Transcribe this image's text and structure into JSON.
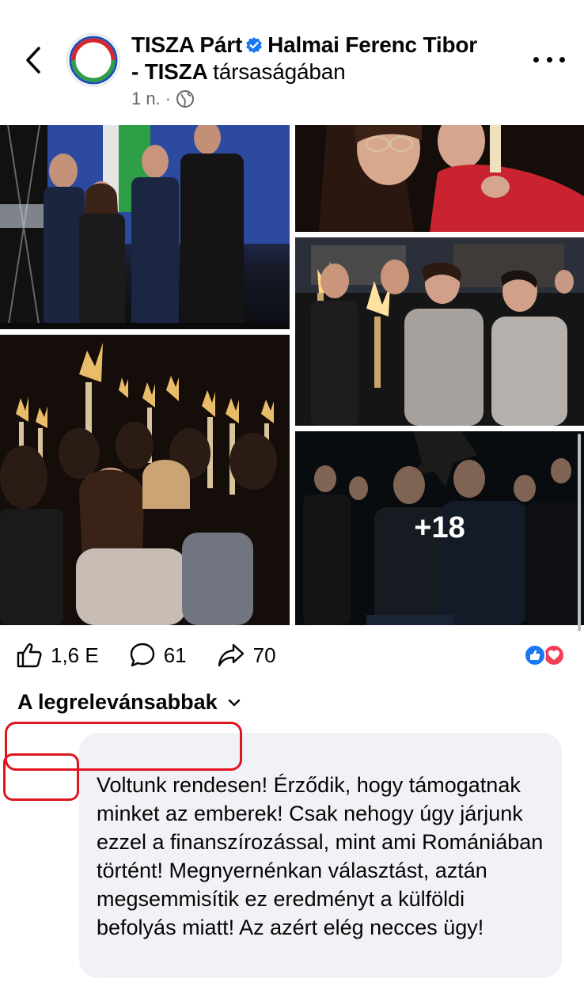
{
  "header": {
    "page_name": "TISZA Párt",
    "with_name": "Halmai Ferenc Tibor",
    "with_name_cont": "- TISZA",
    "suffix": "társaságában",
    "time": "1 n.",
    "dot": "·",
    "privacy_icon": "globe-icon",
    "back_icon": "chevron-left-icon",
    "more_icon": "more-dots-icon",
    "verified_color": "#1877f2"
  },
  "photos": {
    "more_count": "+18"
  },
  "actions": {
    "likes": "1,6 E",
    "comments": "61",
    "shares": "70",
    "like_icon": "thumbs-up-icon",
    "comment_icon": "comment-icon",
    "share_icon": "share-icon"
  },
  "reactions": [
    "like",
    "love"
  ],
  "sort": {
    "label": "A legrelevánsabbak",
    "icon": "chevron-down-icon"
  },
  "comment": {
    "text": "Voltunk rendesen! Érződik, hogy támogatnak minket az emberek! Csak nehogy úgy járjunk ezzel a finanszírozással, mint ami Romániában történt! Megnyernénkan választást, aztán megsemmisítik ez eredményt a külföldi befolyás miatt! Az azért elég necces ügy!"
  },
  "colors": {
    "redaction": "#e0141f",
    "bubble": "#f0f2f5",
    "secondary_text": "#65676b"
  }
}
